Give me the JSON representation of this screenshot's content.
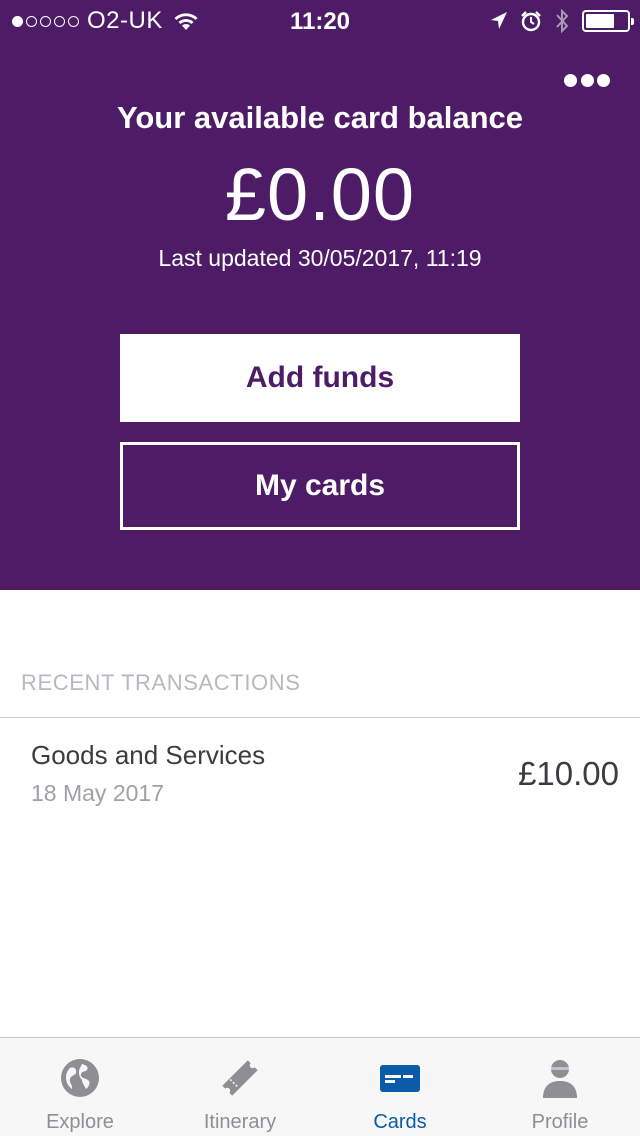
{
  "status_bar": {
    "carrier": "O2-UK",
    "signal_bars": 1,
    "signal_total": 5,
    "time": "11:20",
    "battery_level": 0.7
  },
  "header": {
    "title": "Your available card balance",
    "balance": "£0.00",
    "last_updated": "Last updated 30/05/2017, 11:19",
    "more_icon": "more-horizontal-icon"
  },
  "actions": {
    "add_funds_label": "Add funds",
    "my_cards_label": "My cards"
  },
  "transactions": {
    "section_title": "RECENT TRANSACTIONS",
    "items": [
      {
        "name": "Goods and Services",
        "date": "18 May 2017",
        "amount": "£10.00"
      }
    ]
  },
  "tab_bar": {
    "tabs": [
      {
        "label": "Explore",
        "icon": "globe-icon",
        "active": false
      },
      {
        "label": "Itinerary",
        "icon": "ticket-icon",
        "active": false
      },
      {
        "label": "Cards",
        "icon": "card-icon",
        "active": true
      },
      {
        "label": "Profile",
        "icon": "person-icon",
        "active": false
      }
    ]
  },
  "colors": {
    "brand_purple": "#4e1c66",
    "active_tab_blue": "#0a5ca8",
    "inactive_tab_gray": "#8e8e93"
  }
}
